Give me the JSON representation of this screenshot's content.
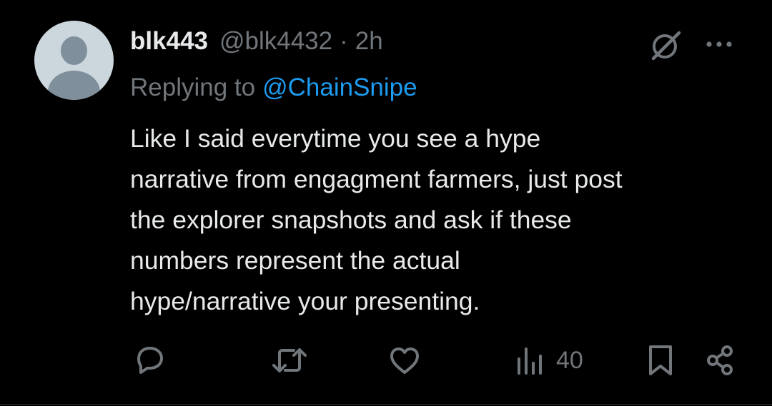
{
  "tweet": {
    "display_name": "blk443",
    "handle": "@blk4432",
    "separator": "·",
    "time": "2h",
    "reply_prefix": "Replying to",
    "reply_to": "@ChainSnipe",
    "text": "Like I said everytime you see a hype\nnarrative from engagment farmers, just post\nthe explorer snapshots and ask if these\nnumbers represent the actual\nhype/narrative your presenting."
  },
  "actions": {
    "views_count": "40"
  },
  "icons": {
    "grok": "grok-icon",
    "more": "more-options-icon",
    "reply": "reply-icon",
    "retweet": "retweet-icon",
    "like": "heart-icon",
    "views": "views-chart-icon",
    "bookmark": "bookmark-icon",
    "share": "share-icon"
  },
  "colors": {
    "background": "#000000",
    "text": "#e7e9ea",
    "secondary": "#71767b",
    "link": "#1d9bf0"
  }
}
